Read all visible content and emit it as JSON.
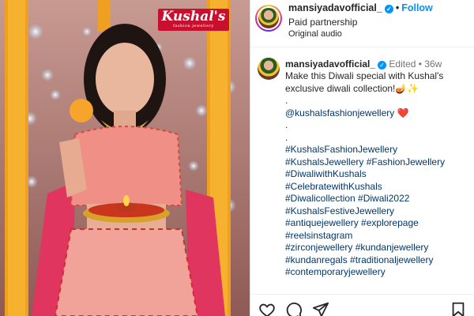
{
  "media": {
    "brand_logo_text": "Kushal's",
    "brand_logo_subtext": "fashion jewellery"
  },
  "header": {
    "username": "mansiyadavofficial_",
    "separator": "•",
    "follow_label": "Follow",
    "partnership": "Paid partnership",
    "audio": "Original audio"
  },
  "caption": {
    "username": "mansiyadavofficial_",
    "edited": "Edited",
    "dot": "•",
    "age": "36w",
    "lines": [
      {
        "text": "Make this Diwali special with Kushal's",
        "type": "text"
      },
      {
        "text": "exclusive diwali collection!🪔✨",
        "type": "text"
      },
      {
        "text": ".",
        "type": "text"
      },
      {
        "text": "@kushalsfashionjewellery",
        "type": "tag",
        "suffix": " ❤️"
      },
      {
        "text": ".",
        "type": "text"
      },
      {
        "text": ".",
        "type": "text"
      },
      {
        "text": "#KushalsFashionJewellery",
        "type": "tag"
      },
      {
        "text": "#KushalsJewellery #FashionJewellery",
        "type": "tag"
      },
      {
        "text": "#DiwaliwithKushals",
        "type": "tag"
      },
      {
        "text": "#CelebratewithKushals",
        "type": "tag"
      },
      {
        "text": "#Diwalicollection #Diwali2022",
        "type": "tag"
      },
      {
        "text": "#KushalsFestiveJewellery",
        "type": "tag"
      },
      {
        "text": "#antiquejewellery #explorepage",
        "type": "tag"
      },
      {
        "text": "#reelsinstagram",
        "type": "tag"
      },
      {
        "text": "#zirconjewellery #kundanjewellery",
        "type": "tag"
      },
      {
        "text": "#kundanregals #traditionaljewellery",
        "type": "tag"
      },
      {
        "text": "#contemporaryjewellery",
        "type": "tag"
      }
    ]
  },
  "actions": {
    "icons": [
      "heart-icon",
      "comment-icon",
      "share-icon",
      "bookmark-icon"
    ]
  },
  "colors": {
    "link_blue": "#0095f6",
    "hashtag": "#00376b",
    "meta_gray": "#737373",
    "brand_red": "#c8102e"
  }
}
